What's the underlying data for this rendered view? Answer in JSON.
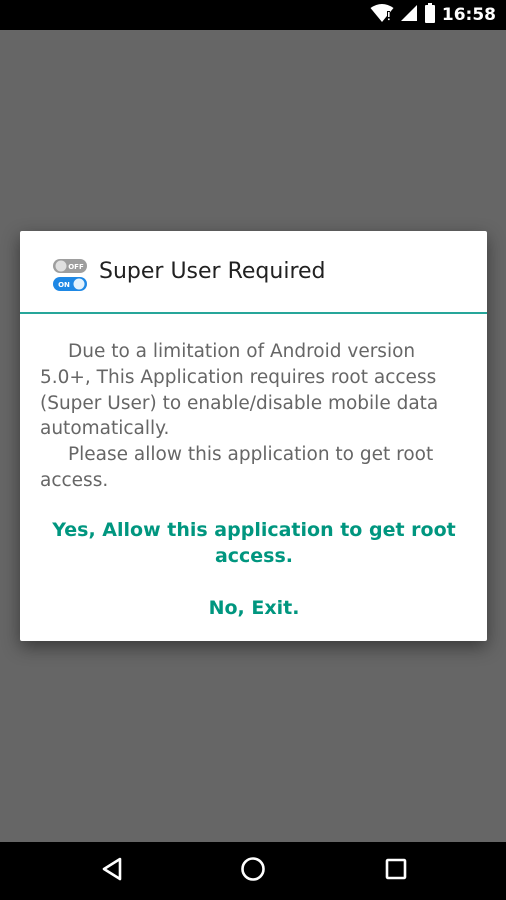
{
  "status_bar": {
    "time": "16:58",
    "icons": [
      "wifi-icon",
      "signal-icon",
      "battery-icon"
    ]
  },
  "dialog": {
    "icon": "toggle-switch-icon",
    "icon_labels": {
      "off": "OFF",
      "on": "ON"
    },
    "title": "Super User Required",
    "message_lines": [
      "Due to a limitation of Android version",
      "5.0+, This Application requires root access",
      "(Super User) to enable/disable mobile data",
      "automatically.",
      "Please allow this application to get root",
      "access."
    ],
    "actions": {
      "allow_line1": "Yes, Allow this application to get root",
      "allow_line2": "access.",
      "exit": "No, Exit."
    },
    "accent_color": "#00967f",
    "divider_color": "#26a69a"
  },
  "nav_bar": {
    "buttons": [
      "back-icon",
      "home-icon",
      "recents-icon"
    ]
  }
}
